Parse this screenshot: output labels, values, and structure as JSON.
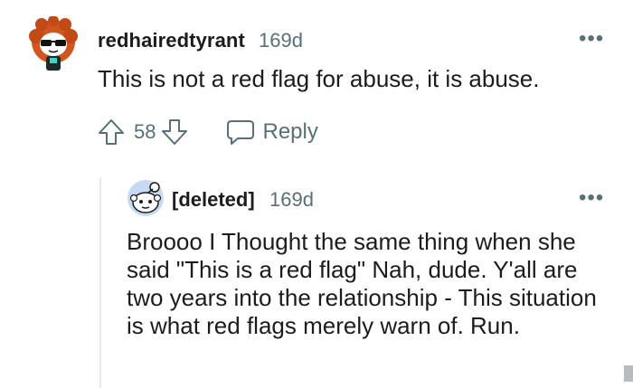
{
  "comments": [
    {
      "author": "redhairedtyrant",
      "age": "169d",
      "body": "This is not a red flag for abuse, it is abuse.",
      "score": "58",
      "reply_label": "Reply",
      "more_label": "•••"
    },
    {
      "author": "[deleted]",
      "age": "169d",
      "body": "Broooo I Thought the same thing when she said \"This is a red flag\" Nah, dude. Y'all are two years into the relationship - This situation is what red flags merely warn of. Run.",
      "more_label": "•••"
    }
  ],
  "icons": {
    "upvote": "upvote-arrow-icon",
    "downvote": "downvote-arrow-icon",
    "reply": "speech-bubble-icon",
    "more": "more-options-icon"
  },
  "colors": {
    "text": "#1c1c1c",
    "meta": "#576f76",
    "thread_line": "#e5ebee"
  }
}
